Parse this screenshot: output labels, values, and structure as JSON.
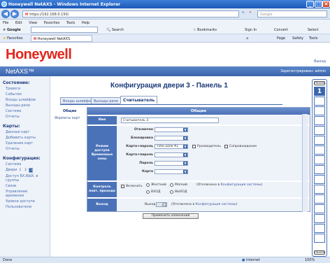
{
  "window": {
    "title": "Honeywell NetAXS - Windows Internet Explorer"
  },
  "browser": {
    "url": "https://192.168.0.150/",
    "search_engine": "Google",
    "menu": [
      "File",
      "Edit",
      "View",
      "Favorites",
      "Tools",
      "Help"
    ],
    "google_toolbar": {
      "search_label": "Search",
      "bookmarks_label": "Bookmarks",
      "signin_label": "Sign In",
      "convert_label": "Convert",
      "select_label": "Select"
    },
    "favorites_label": "Favorites",
    "tab_title": "Honeywell NetAXS",
    "command_bar": {
      "page": "Page",
      "safety": "Safety",
      "tools": "Tools"
    }
  },
  "app": {
    "logo": "Honeywell",
    "product": "NetAXS™",
    "logout": "Выход",
    "user_info": "Зарегистрирован: admin"
  },
  "nav": {
    "status_heading": "Состояние:",
    "status_items": [
      "Тревоги",
      "События",
      "Входы шлейфов",
      "Выходы реле",
      "Система",
      "Отчеты"
    ],
    "cards_heading": "Карты:",
    "cards_items": [
      "Данные карт",
      "Добавить карты",
      "Удаление карт",
      "Отчеты"
    ],
    "config_heading": "Конфигурация:",
    "config_items_before": [
      "Система"
    ],
    "doors_label": "Двери",
    "doors_pages": [
      "1",
      "2",
      "3",
      "4"
    ],
    "doors_selected_index": 2,
    "config_items_after": [
      "Доступ ВХ.ВЫХ. в группы",
      "Связи",
      "Управление временем",
      "Уровни доступа",
      "Пользователи"
    ]
  },
  "main": {
    "heading": "Конфигурация двери 3 - Панель 1",
    "tabs": [
      "Входы шлейфов",
      "Выходы реле",
      "Считыватель"
    ],
    "active_tab_index": 2,
    "subnav": [
      "Общие",
      "Форматы карт"
    ],
    "form": {
      "section_title": "Общие",
      "name_label": "Имя",
      "name_value": "Считыватель 3",
      "access_mode_label": "Режим доступа Временные зоны",
      "access_rows": [
        {
          "label": "Отключен",
          "value": ""
        },
        {
          "label": "Блокировка",
          "value": ""
        },
        {
          "label": "Карта+пароль",
          "value": "Time Zone #1"
        },
        {
          "label": "Карта+пароль",
          "value": ""
        },
        {
          "label": "Пароль",
          "value": ""
        },
        {
          "label": "Карта",
          "value": ""
        }
      ],
      "supervisor_label": "Руководитель",
      "escort_label": "Сопровождение",
      "passback_label": "Контроль повт. прохода",
      "passback_enable": "Включить",
      "strict_label": "Жесткий",
      "soft_label": "Мягкий",
      "passback_note_prefix": "(Отключено в",
      "passback_note_link": "Конфигурация системы",
      "passback_note_suffix": ")",
      "in_label": "ВХОД",
      "out_label": "ВЫХОД",
      "exit_label": "Выход",
      "exit_field_label": "Выход",
      "exit_value": "",
      "exit_note_prefix": "(Отключено в",
      "exit_note_link": "Конфигурация системы",
      "exit_note_suffix": ")",
      "apply_button": "Применить изменения"
    }
  },
  "right_panel": {
    "top_label": "Панель",
    "bottom_label": "Панель",
    "active_panel": "1"
  },
  "statusbar": {
    "zone": "Internet",
    "zoom": "100%",
    "left_text": "Done"
  }
}
